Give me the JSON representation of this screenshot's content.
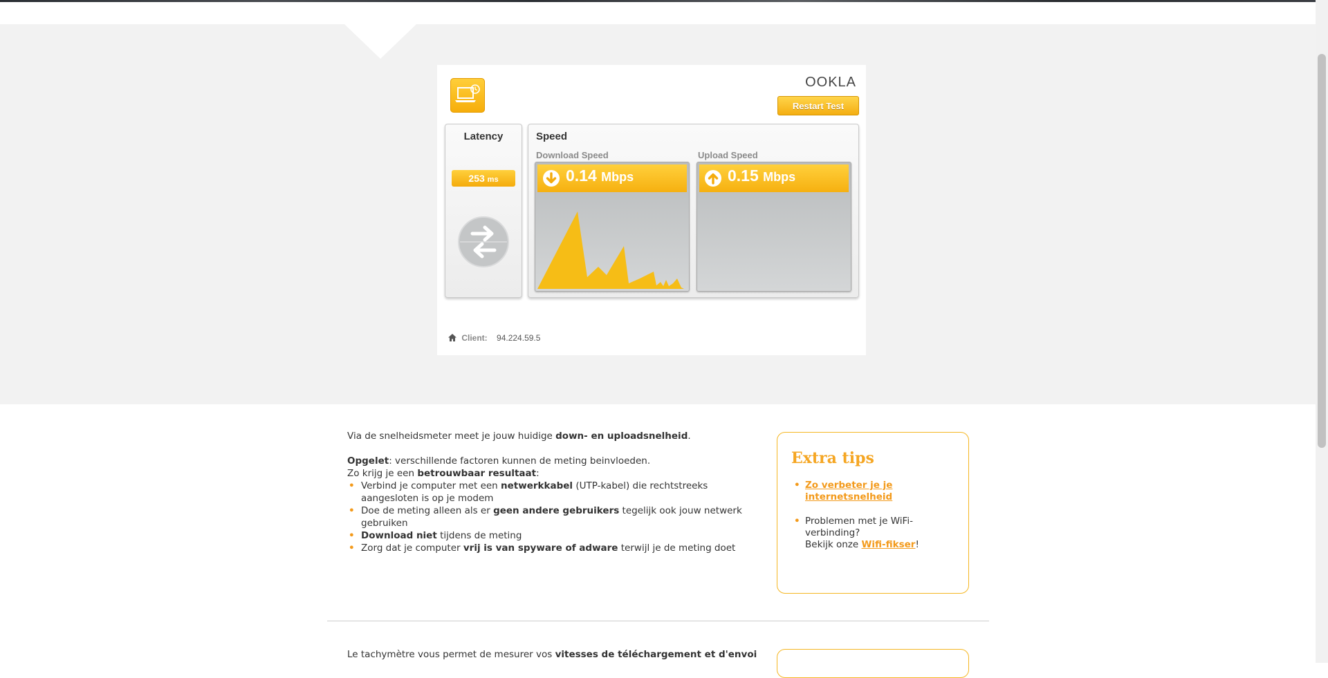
{
  "widget": {
    "brand": "OOKLA",
    "restart_label": "Restart Test",
    "latency": {
      "title": "Latency",
      "value": "253",
      "unit": "ms"
    },
    "speed": {
      "title": "Speed",
      "download": {
        "label": "Download Speed",
        "value": "0.14",
        "unit": "Mbps"
      },
      "upload": {
        "label": "Upload Speed",
        "value": "0.15",
        "unit": "Mbps"
      }
    },
    "client": {
      "label": "Client:",
      "ip": "94.224.59.5"
    }
  },
  "info": {
    "intro_a": "Via de snelheidsmeter meet je jouw huidige ",
    "intro_b": "down- en uploadsnelheid",
    "intro_c": ".",
    "warn_a": "Opgelet",
    "warn_b": ": verschillende factoren kunnen de meting beinvloeden.",
    "reliable_a": "Zo krijg je een ",
    "reliable_b": "betrouwbaar resultaat",
    "reliable_c": ":",
    "tip1_a": "Verbind je computer met een ",
    "tip1_b": "netwerkkabel",
    "tip1_c": " (UTP-kabel) die rechtstreeks aangesloten is op je modem",
    "tip2_a": "Doe de meting alleen als er ",
    "tip2_b": "geen andere gebruikers",
    "tip2_c": " tegelijk ook jouw netwerk gebruiken",
    "tip3_a": "Download niet",
    "tip3_b": " tijdens de meting",
    "tip4_a": "Zorg dat je computer ",
    "tip4_b": "vrij is van spyware of adware",
    "tip4_c": " terwijl je de meting doet"
  },
  "extra_tips": {
    "title": "Extra tips",
    "link1": "Zo verbeter je je internetsnelheid",
    "wifi_text": "Problemen met je WiFi-verbinding?",
    "wifi_prefix": "Bekijk onze ",
    "wifi_link": "Wifi-fikser",
    "wifi_suffix": "!"
  },
  "footer": {
    "fr_a": "Le tachymètre vous permet de mesurer vos ",
    "fr_b": "vitesses de téléchargement et d'envoi"
  },
  "colors": {
    "accent": "#f5a623",
    "bullet": "#f39a1b",
    "gauge_bg": "#c6c8c9"
  },
  "icons": [
    "laptop-icon",
    "ping-arrows-icon",
    "download-arrow-icon",
    "upload-arrow-icon",
    "home-icon"
  ]
}
